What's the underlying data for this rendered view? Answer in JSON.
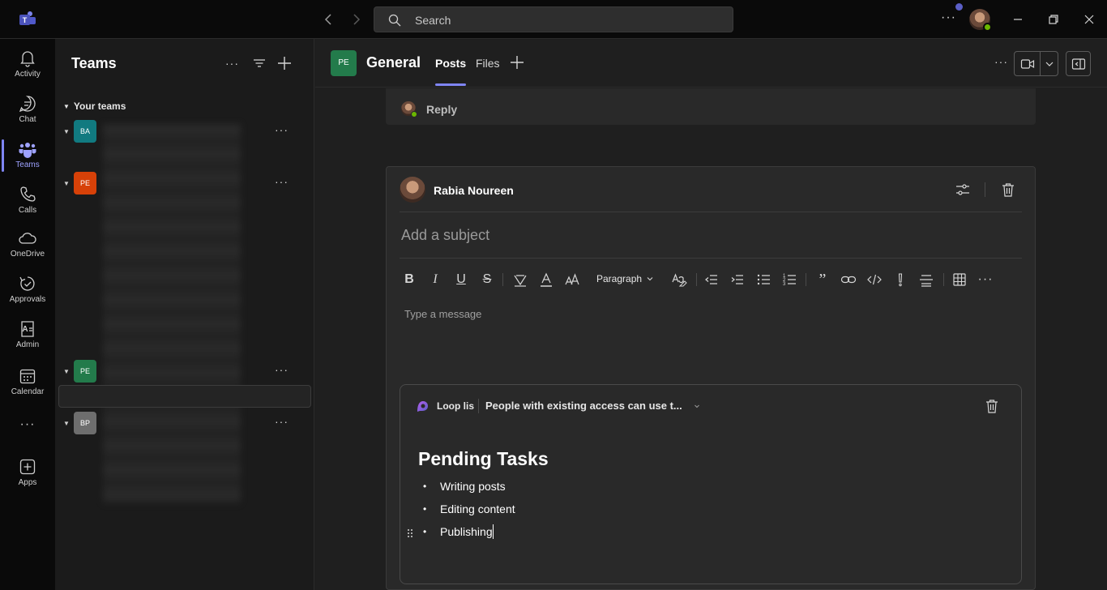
{
  "titlebar": {
    "search_placeholder": "Search"
  },
  "rail": {
    "items": [
      {
        "label": "Activity",
        "icon": "bell-icon"
      },
      {
        "label": "Chat",
        "icon": "chat-icon"
      },
      {
        "label": "Teams",
        "icon": "teams-icon",
        "active": true
      },
      {
        "label": "Calls",
        "icon": "phone-icon"
      },
      {
        "label": "OneDrive",
        "icon": "cloud-icon"
      },
      {
        "label": "Approvals",
        "icon": "approvals-icon"
      },
      {
        "label": "Admin",
        "icon": "admin-icon"
      },
      {
        "label": "Calendar",
        "icon": "calendar-icon"
      },
      {
        "label": "",
        "icon": "more-icon"
      },
      {
        "label": "Apps",
        "icon": "apps-icon"
      }
    ]
  },
  "teams_panel": {
    "title": "Teams",
    "section": "Your teams",
    "teams": [
      {
        "initials": "BA",
        "color": "#117a80"
      },
      {
        "initials": "PE",
        "color": "#d74108"
      },
      {
        "initials": "PE",
        "color": "#237b4b"
      },
      {
        "initials": "BP",
        "color": "#6e6e6e"
      }
    ]
  },
  "channel": {
    "initials": "PE",
    "name": "General",
    "tabs": [
      "Posts",
      "Files"
    ]
  },
  "reply": {
    "label": "Reply"
  },
  "compose": {
    "author": "Rabia Noureen",
    "subject_placeholder": "Add a subject",
    "paragraph_label": "Paragraph",
    "message_placeholder": "Type a message",
    "loop": {
      "name": "Loop lis",
      "permission": "People with existing access can use t...",
      "heading": "Pending Tasks",
      "items": [
        "Writing posts",
        "Editing content",
        "Publishing"
      ]
    }
  },
  "colors": {
    "accent": "#7f85f5",
    "presence": "#6bb700"
  }
}
